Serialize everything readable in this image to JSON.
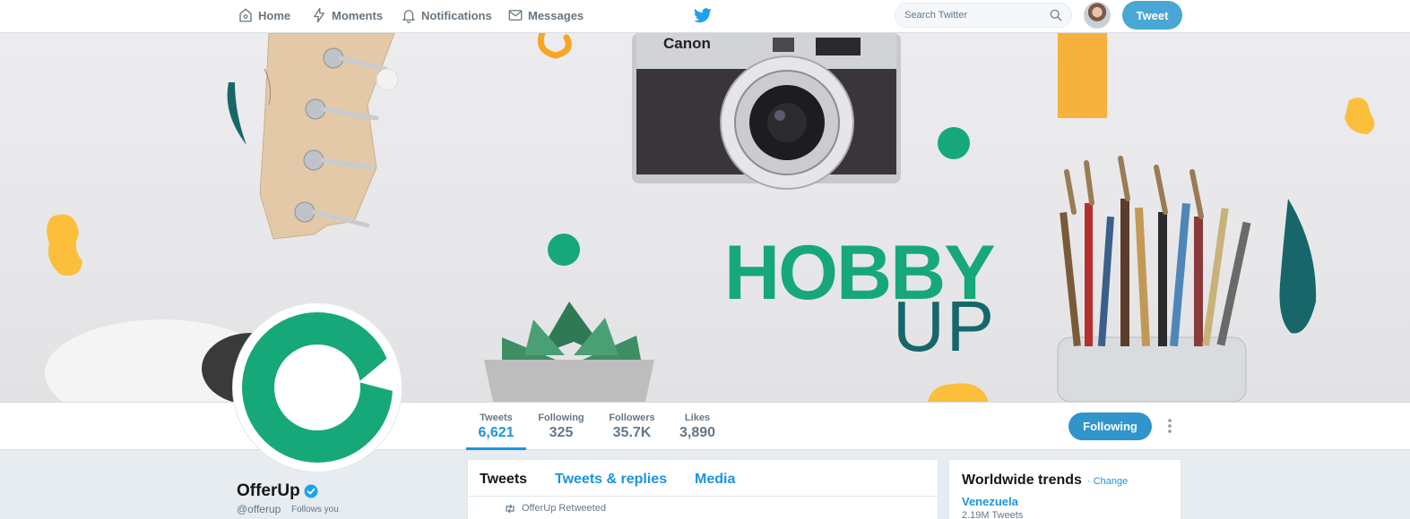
{
  "topnav": {
    "items": [
      {
        "label": "Home",
        "icon": "home-icon"
      },
      {
        "label": "Moments",
        "icon": "lightning-icon"
      },
      {
        "label": "Notifications",
        "icon": "bell-icon"
      },
      {
        "label": "Messages",
        "icon": "envelope-icon"
      }
    ],
    "search_placeholder": "Search Twitter",
    "tweet_button": "Tweet"
  },
  "banner": {
    "headline_1": "HOBBY",
    "headline_2": "UP",
    "camera_brand": "Canon"
  },
  "profile": {
    "name": "OfferUp",
    "handle": "@offerup",
    "follows_you": "Follows you",
    "verified": true,
    "stats": [
      {
        "label": "Tweets",
        "value": "6,621",
        "active": true
      },
      {
        "label": "Following",
        "value": "325"
      },
      {
        "label": "Followers",
        "value": "35.7K"
      },
      {
        "label": "Likes",
        "value": "3,890"
      }
    ],
    "following_button": "Following"
  },
  "timeline": {
    "tabs": [
      "Tweets",
      "Tweets & replies",
      "Media"
    ],
    "retweet_label": "OfferUp Retweeted"
  },
  "trends": {
    "title": "Worldwide trends",
    "change": "· Change",
    "items": [
      {
        "name": "Venezuela",
        "count": "2.19M Tweets"
      }
    ]
  },
  "colors": {
    "brand_blue": "#1b95e0",
    "button_blue": "#2f95cc",
    "offerup_green": "#17a87a",
    "teal": "#16676a",
    "yellow": "#fbbf3c"
  }
}
